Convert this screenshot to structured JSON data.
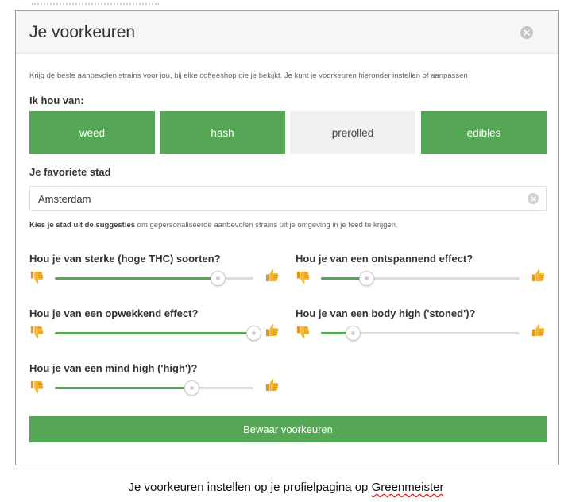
{
  "modal": {
    "title": "Je voorkeuren",
    "intro": "Krijg de beste aanbevolen strains voor jou, bij elke coffeeshop die je bekijkt. Je kunt je voorkeuren hieronder instellen of aanpassen",
    "like_heading": "Ik hou van:",
    "products": [
      {
        "label": "weed",
        "selected": true
      },
      {
        "label": "hash",
        "selected": true
      },
      {
        "label": "prerolled",
        "selected": false
      },
      {
        "label": "edibles",
        "selected": true
      }
    ],
    "city": {
      "heading": "Je favoriete stad",
      "value": "Amsterdam",
      "help_bold": "Kies je stad uit de suggesties",
      "help_rest": " om gepersonaliseerde aanbevolen strains uit je omgeving in je feed te krijgen."
    },
    "questions": [
      {
        "label": "Hou je van sterke (hoge THC) soorten?",
        "value": 0.82
      },
      {
        "label": "Hou je van een ontspannend effect?",
        "value": 0.23
      },
      {
        "label": "Hou je van een opwekkend effect?",
        "value": 1.0
      },
      {
        "label": "Hou je van een body high ('stoned')?",
        "value": 0.16
      },
      {
        "label": "Hou je van een mind high ('high')?",
        "value": 0.69
      }
    ],
    "save_label": "Bewaar voorkeuren"
  },
  "caption": {
    "text_before": "Je voorkeuren instellen op je profielpagina op ",
    "brand": "Greenmeister"
  },
  "colors": {
    "accent": "#55a755",
    "unselected": "#f0f0f0",
    "track": "#dcdcdc",
    "thumb_emoji": "#f2a81e"
  },
  "icons": {
    "close": "close-icon",
    "clear": "clear-input-icon",
    "dislike": "thumbs-down-icon",
    "like": "thumbs-up-icon"
  }
}
